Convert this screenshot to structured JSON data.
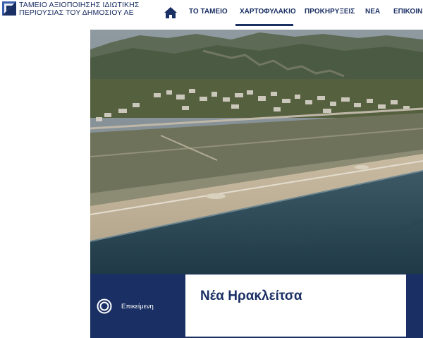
{
  "brand": {
    "line1": "ΤΑΜΕΙΟ ΑΞΙΟΠΟΙΗΣΗΣ ΙΔΙΩΤΙΚΗΣ",
    "line2": "ΠΕΡΙΟΥΣΙΑΣ ΤΟΥ ΔΗΜΟΣΙΟΥ ΑΕ",
    "color": "#1a2f63"
  },
  "nav": {
    "home_icon": "home-icon",
    "items": [
      {
        "label": "ΤΟ ΤΑΜΕΙΟ"
      },
      {
        "label": "ΧΑΡΤΟΦΥΛΑΚΙΟ",
        "active": true
      },
      {
        "label": "ΠΡΟΚΗΡΥΞΕΙΣ"
      },
      {
        "label": "ΝΕΑ"
      },
      {
        "label": "ΕΠΙΚΟΙΝ"
      }
    ]
  },
  "property": {
    "status_icon": "radio-ring-icon",
    "status_label": "Επικείμενη",
    "title": "Νέα Ηρακλείτσα"
  }
}
